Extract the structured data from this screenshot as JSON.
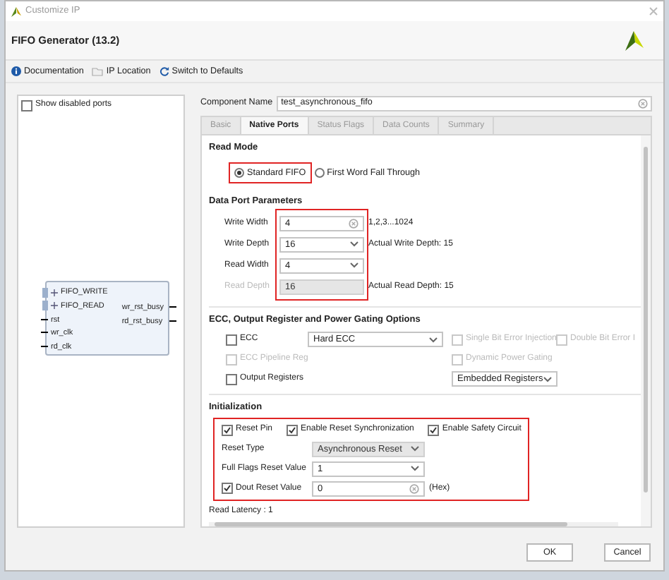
{
  "window": {
    "title": "Customize IP"
  },
  "header": {
    "title": "FIFO Generator (13.2)"
  },
  "toolbar": [
    {
      "kind": "info",
      "label": "Documentation"
    },
    {
      "kind": "folder",
      "label": "IP Location"
    },
    {
      "kind": "refresh",
      "label": "Switch to Defaults"
    }
  ],
  "left_panel": {
    "show_disabled_ports": {
      "label": "Show disabled ports",
      "checked": false
    },
    "symbol": {
      "left_ports": [
        {
          "kind": "bus",
          "label": "FIFO_WRITE"
        },
        {
          "kind": "bus",
          "label": "FIFO_READ"
        },
        {
          "kind": "pin",
          "label": "rst"
        },
        {
          "kind": "pin",
          "label": "wr_clk"
        },
        {
          "kind": "pin",
          "label": "rd_clk"
        }
      ],
      "right_ports": [
        "wr_rst_busy",
        "rd_rst_busy"
      ]
    }
  },
  "component_name": {
    "label": "Component Name",
    "value": "test_asynchronous_fifo"
  },
  "tabs": [
    {
      "label": "Basic",
      "selected": false
    },
    {
      "label": "Native Ports",
      "selected": true
    },
    {
      "label": "Status Flags",
      "selected": false
    },
    {
      "label": "Data Counts",
      "selected": false
    },
    {
      "label": "Summary",
      "selected": false
    }
  ],
  "read_mode": {
    "title": "Read Mode",
    "highlighted": true,
    "options": [
      {
        "label": "Standard FIFO",
        "selected": true
      },
      {
        "label": "First Word Fall Through",
        "selected": false
      }
    ]
  },
  "data_port_parameters": {
    "title": "Data Port Parameters",
    "highlighted": true,
    "fields": [
      {
        "label": "Write Width",
        "kind": "text",
        "value": "4",
        "disabled": false,
        "note": "1,2,3...1024"
      },
      {
        "label": "Write Depth",
        "kind": "select",
        "value": "16",
        "disabled": false,
        "note": "Actual Write Depth: 15"
      },
      {
        "label": "Read Width",
        "kind": "select",
        "value": "4",
        "disabled": false
      },
      {
        "label": "Read Depth",
        "kind": "text",
        "value": "16",
        "disabled": true,
        "note": "Actual Read Depth: 15"
      }
    ]
  },
  "ecc_options": {
    "title": "ECC, Output Register and Power Gating Options",
    "rows": [
      [
        {
          "kind": "checkbox",
          "label": "ECC",
          "checked": false,
          "disabled": false
        },
        {
          "kind": "select",
          "value": "Hard ECC",
          "disabled": false
        },
        {
          "kind": "checkbox",
          "label": "Single Bit Error Injection",
          "checked": false,
          "disabled": true
        },
        {
          "kind": "checkbox",
          "label": "Double Bit Error I",
          "checked": false,
          "disabled": true
        }
      ],
      [
        {
          "kind": "checkbox",
          "label": "ECC Pipeline Reg",
          "checked": false,
          "disabled": true
        },
        {
          "kind": "checkbox",
          "label": "Dynamic Power Gating",
          "checked": false,
          "disabled": true
        }
      ],
      [
        {
          "kind": "checkbox",
          "label": "Output Registers",
          "checked": false,
          "disabled": false
        },
        {
          "kind": "select",
          "value": "Embedded Registers",
          "disabled": false
        }
      ]
    ]
  },
  "initialization": {
    "title": "Initialization",
    "highlighted": true,
    "checks": [
      {
        "label": "Reset Pin",
        "checked": true
      },
      {
        "label": "Enable Reset Synchronization",
        "checked": true
      },
      {
        "label": "Enable Safety Circuit",
        "checked": true
      }
    ],
    "fields": [
      {
        "kind": "select",
        "label": "Reset Type",
        "value": "Asynchronous Reset",
        "disabled": true
      },
      {
        "kind": "select",
        "label": "Full Flags Reset Value",
        "value": "1",
        "disabled": false
      },
      {
        "kind": "checked_text",
        "label": "Dout Reset Value",
        "checked": true,
        "value": "0",
        "disabled": false,
        "note": "(Hex)"
      }
    ]
  },
  "read_latency": "Read Latency : 1",
  "buttons": [
    "OK",
    "Cancel"
  ]
}
